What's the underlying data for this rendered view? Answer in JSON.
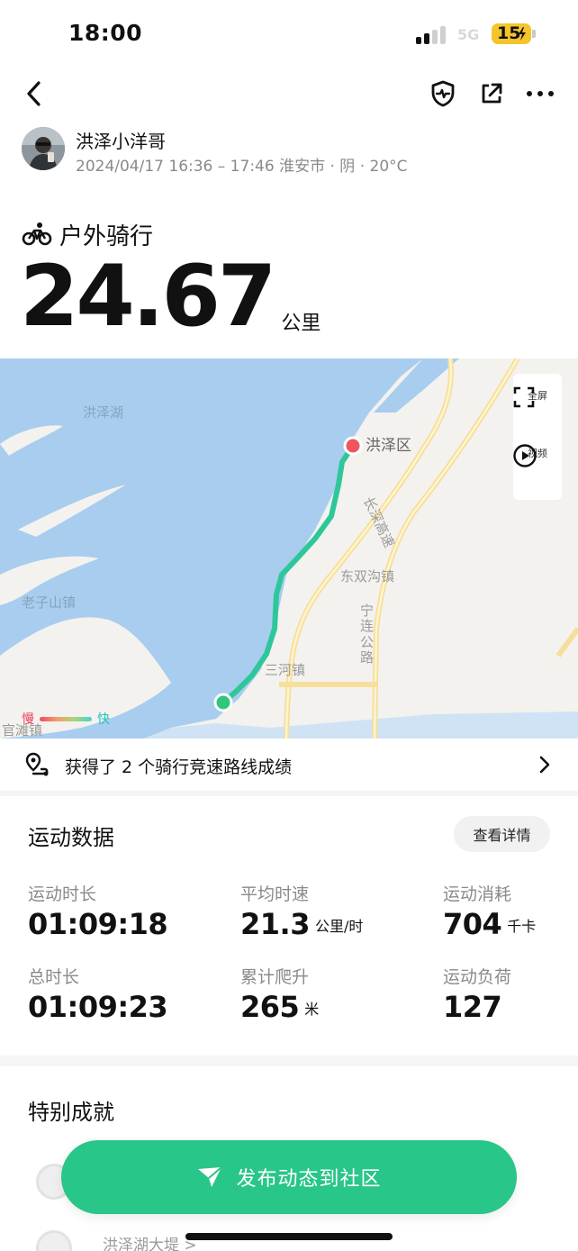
{
  "status_bar": {
    "time": "18:00",
    "network": "5G",
    "battery": "15"
  },
  "user": {
    "name": "洪泽小洋哥",
    "meta": "2024/04/17 16:36 – 17:46 淮安市 · 阴 · 20°C"
  },
  "activity": {
    "type_label": "户外骑行",
    "distance": "24.67",
    "distance_unit": "公里"
  },
  "map": {
    "labels": {
      "lake": "洪泽湖",
      "city": "洪泽区",
      "highway": "长深高速",
      "town1": "东双沟镇",
      "town2": "老子山镇",
      "town3": "三河镇",
      "town4": "官滩镇",
      "road": "宁连公路"
    },
    "fullscreen_label": "全屏",
    "video_label": "视频",
    "legend_slow": "慢",
    "legend_fast": "快",
    "colors": {
      "water": "#a8cdef",
      "route": "#2ec79a",
      "start": "#2ec77d",
      "end": "#ef5561"
    }
  },
  "segments": {
    "text": "获得了 2 个骑行竞速路线成绩"
  },
  "stats": {
    "title": "运动数据",
    "details_label": "查看详情",
    "items": [
      {
        "label": "运动时长",
        "value": "01:09:18",
        "unit": ""
      },
      {
        "label": "平均时速",
        "value": "21.3",
        "unit": "公里/时"
      },
      {
        "label": "运动消耗",
        "value": "704",
        "unit": "千卡"
      },
      {
        "label": "总时长",
        "value": "01:09:23",
        "unit": ""
      },
      {
        "label": "累计爬升",
        "value": "265",
        "unit": "米"
      },
      {
        "label": "运动负荷",
        "value": "127",
        "unit": ""
      }
    ]
  },
  "achievements": {
    "title": "特别成就",
    "item": "洪泽湖大堤 >"
  },
  "publish": {
    "label": "发布动态到社区",
    "color": "#28c688"
  }
}
